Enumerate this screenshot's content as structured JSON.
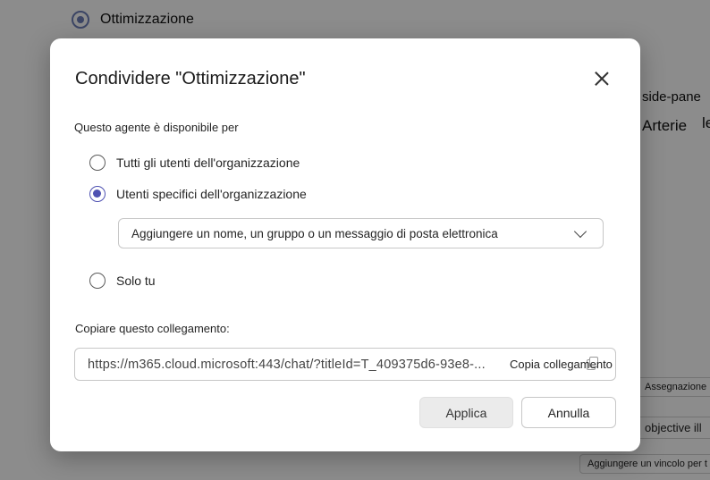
{
  "background": {
    "app_title": "Ottimizzazione",
    "side_text_1": "side-pane",
    "side_text_2": "Arterie",
    "side_text_2b": "le",
    "chip_1": "Assegnazione",
    "chip_2": "objective ill",
    "chip_3": "Aggiungere un vincolo per t"
  },
  "dialog": {
    "title": "Condividere \"Ottimizzazione\"",
    "availability_label": "Questo agente è disponibile per",
    "options": [
      {
        "label": "Tutti gli utenti dell'organizzazione",
        "checked": false
      },
      {
        "label": "Utenti specifici dell'organizzazione",
        "checked": true
      },
      {
        "label": "Solo tu",
        "checked": false
      }
    ],
    "people_picker": {
      "placeholder": "Aggiungere un nome, un gruppo o un messaggio di posta elettronica"
    },
    "copy_link_label": "Copiare questo collegamento:",
    "link_value": "https://m365.cloud.microsoft:443/chat/?titleId=T_409375d6-93e8-...",
    "copy_link_button": "Copia collegamento",
    "apply_button": "Applica",
    "cancel_button": "Annulla"
  },
  "colors": {
    "accent": "#4f52b2",
    "overlay": "#000000"
  }
}
